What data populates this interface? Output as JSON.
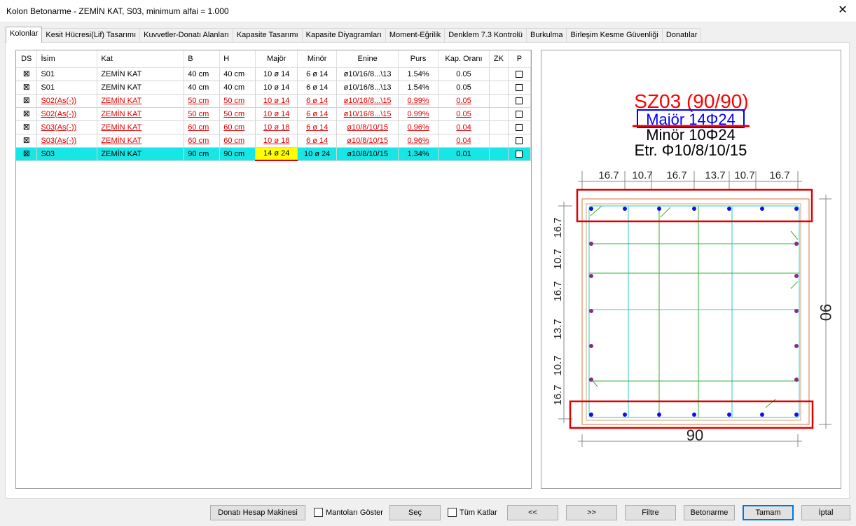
{
  "window": {
    "title": "Kolon Betonarme - ZEMİN KAT, S03, minimum alfai = 1.000",
    "close_glyph": "✕"
  },
  "tabs": [
    "Kolonlar",
    "Kesit Hücresi(Lif) Tasarımı",
    "Kuvvetler-Donatı Alanları",
    "Kapasite Tasarımı",
    "Kapasite Diyagramları",
    "Moment-Eğrilik",
    "Denklem 7.3 Kontrolü",
    "Burkulma",
    "Birleşim Kesme Güvenliği",
    "Donatılar"
  ],
  "table": {
    "headers": [
      "DS",
      "İsim",
      "Kat",
      "B",
      "H",
      "Majör",
      "Minör",
      "Enine",
      "Purs",
      "Kap. Oranı",
      "ZK",
      "P"
    ],
    "ds_mark": "⊠",
    "rows": [
      {
        "name": "S01",
        "kat": "ZEMİN KAT",
        "b": "40 cm",
        "h": "40 cm",
        "major": "10 ø 14",
        "minor": "6 ø 14",
        "enine": "ø10/16/8...\\13",
        "purs": "1.54%",
        "kap": "0.05",
        "zk": ""
      },
      {
        "name": "S01",
        "kat": "ZEMİN KAT",
        "b": "40 cm",
        "h": "40 cm",
        "major": "10 ø 14",
        "minor": "6 ø 14",
        "enine": "ø10/16/8...\\13",
        "purs": "1.54%",
        "kap": "0.05",
        "zk": ""
      },
      {
        "name": "S02(As(-))",
        "kat": "ZEMİN KAT",
        "b": "50 cm",
        "h": "50 cm",
        "major": "10 ø 14",
        "minor": "6 ø 14",
        "enine": "ø10/16/8...\\15",
        "purs": "0.99%",
        "kap": "0.05",
        "zk": ""
      },
      {
        "name": "S02(As(-))",
        "kat": "ZEMİN KAT",
        "b": "50 cm",
        "h": "50 cm",
        "major": "10 ø 14",
        "minor": "6 ø 14",
        "enine": "ø10/16/8...\\15",
        "purs": "0.99%",
        "kap": "0.05",
        "zk": ""
      },
      {
        "name": "S03(As(-))",
        "kat": "ZEMİN KAT",
        "b": "60 cm",
        "h": "60 cm",
        "major": "10 ø 18",
        "minor": "6 ø 14",
        "enine": "ø10/8/10/15",
        "purs": "0.96%",
        "kap": "0.04",
        "zk": ""
      },
      {
        "name": "S03(As(-))",
        "kat": "ZEMİN KAT",
        "b": "60 cm",
        "h": "60 cm",
        "major": "10 ø 18",
        "minor": "6 ø 14",
        "enine": "ø10/8/10/15",
        "purs": "0.96%",
        "kap": "0.04",
        "zk": ""
      },
      {
        "name": "S03",
        "kat": "ZEMİN KAT",
        "b": "90 cm",
        "h": "90 cm",
        "major": "14 ø 24",
        "minor": "10 ø 24",
        "enine": "ø10/8/10/15",
        "purs": "1.34%",
        "kap": "0.01",
        "zk": ""
      }
    ]
  },
  "section": {
    "title": "SZ03 (90/90)",
    "major": "Majör 14Φ24",
    "minor": "Minör 10Φ24",
    "stirrup": "Etr. Φ10/8/10/15",
    "top_dims": [
      "16.7",
      "10.7",
      "16.7",
      "13.7",
      "10.7",
      "16.7"
    ],
    "left_dims": [
      "16.7",
      "10.7",
      "16.7",
      "13.7",
      "10.7",
      "16.7"
    ],
    "width_label": "90",
    "height_label": "90"
  },
  "buttons": {
    "calc": "Donatı Hesap Makinesi",
    "mantolar": "Mantoları Göster",
    "sec": "Seç",
    "tum_katlar": "Tüm Katlar",
    "prev": "<<",
    "next": ">>",
    "filtre": "Filtre",
    "betonarme": "Betonarme",
    "tamam": "Tamam",
    "iptal": "İptal"
  }
}
